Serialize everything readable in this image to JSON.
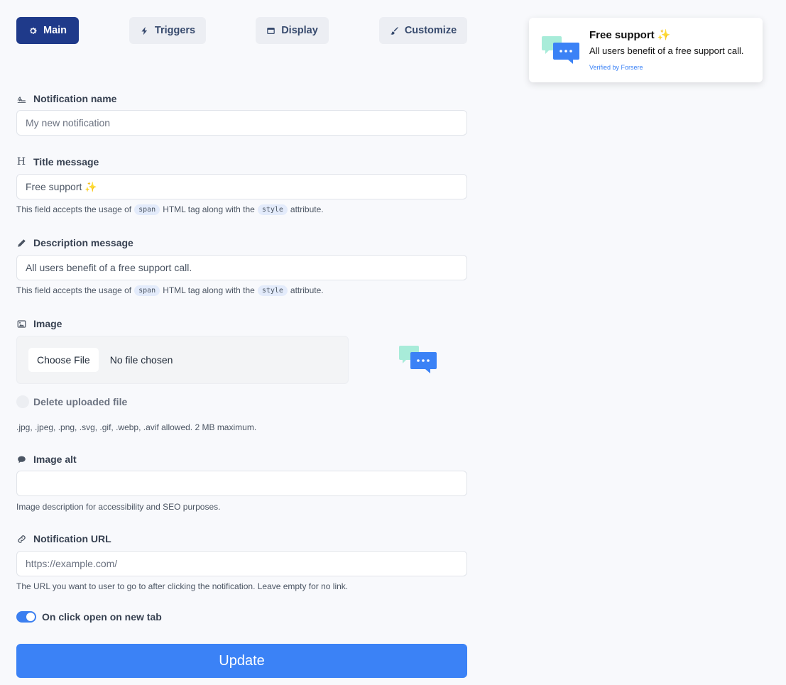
{
  "tabs": {
    "main": "Main",
    "triggers": "Triggers",
    "display": "Display",
    "customize": "Customize"
  },
  "fields": {
    "notification_name": {
      "label": "Notification name",
      "placeholder": "My new notification",
      "value": ""
    },
    "title_message": {
      "label": "Title message",
      "value": "Free support ✨",
      "help_prefix": "This field accepts the usage of",
      "help_tag": "span",
      "help_middle": "HTML tag along with the",
      "help_attr": "style",
      "help_suffix": "attribute."
    },
    "description_message": {
      "label": "Description message",
      "value": "All users benefit of a free support call.",
      "help_prefix": "This field accepts the usage of",
      "help_tag": "span",
      "help_middle": "HTML tag along with the",
      "help_attr": "style",
      "help_suffix": "attribute."
    },
    "image": {
      "label": "Image",
      "choose_label": "Choose File",
      "no_file": "No file chosen",
      "delete_label": "Delete uploaded file",
      "allowed": ".jpg, .jpeg, .png, .svg, .gif, .webp, .avif allowed. 2 MB maximum."
    },
    "image_alt": {
      "label": "Image alt",
      "value": "",
      "help": "Image description for accessibility and SEO purposes."
    },
    "notification_url": {
      "label": "Notification URL",
      "placeholder": "https://example.com/",
      "help": "The URL you want to user to go to after clicking the notification. Leave empty for no link."
    },
    "new_tab": {
      "label": "On click open on new tab",
      "enabled": true
    }
  },
  "update_label": "Update",
  "preview": {
    "title": "Free support ✨",
    "description": "All users benefit of a free support call.",
    "verified": "Verified by Forsere"
  },
  "colors": {
    "accent": "#3b82f6",
    "active_tab": "#1f3a8a",
    "bubble_back": "#a8ecd9",
    "bubble_front": "#3b82f6"
  }
}
